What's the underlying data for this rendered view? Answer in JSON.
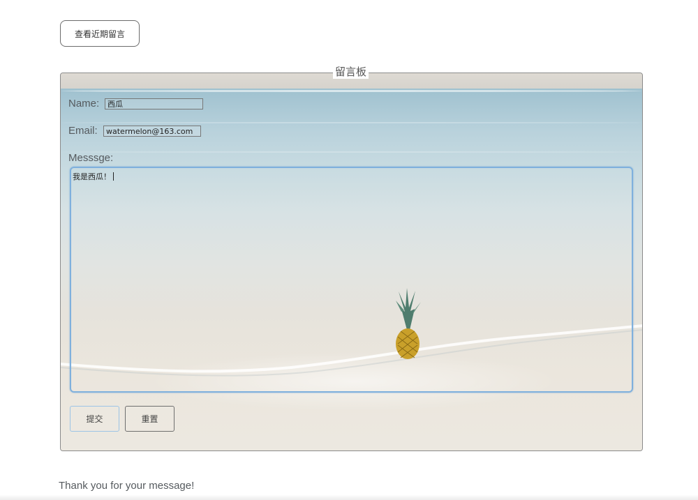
{
  "header": {
    "view_recent_label": "查看近期留言"
  },
  "board": {
    "legend": "留言板",
    "name_label": "Name:",
    "name_value": "西瓜",
    "email_label": "Email:",
    "email_value": "watermelon@163.com",
    "message_label": "Messsge:",
    "message_value": "我是西瓜！",
    "submit_label": "提交",
    "reset_label": "重置",
    "background_image": "beach-with-pineapple"
  },
  "footer": {
    "thanks": "Thank you for your message!"
  },
  "colors": {
    "focus_border": "#7fb0dd",
    "text_gray": "#555a5e"
  }
}
